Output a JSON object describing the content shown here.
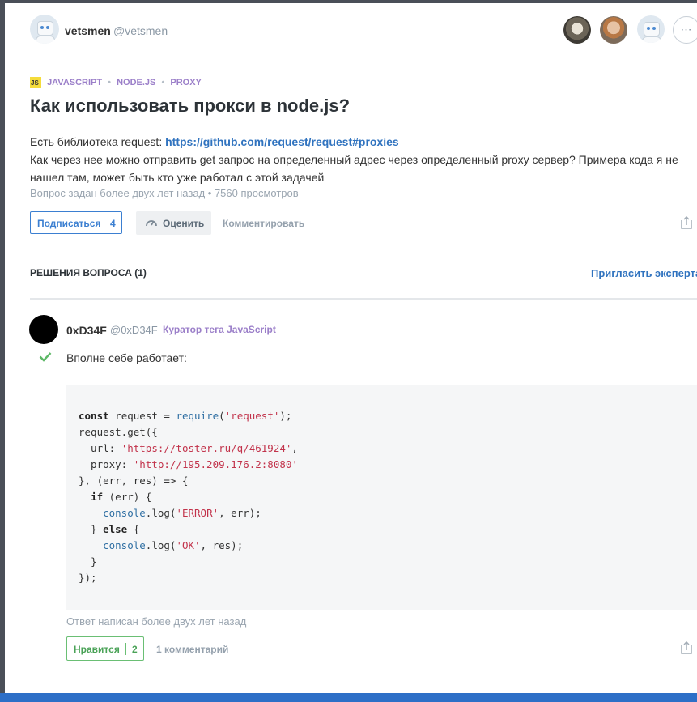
{
  "author": {
    "name": "vetsmen",
    "handle": "@vetsmen"
  },
  "subscribers_more_label": "⋯",
  "question": {
    "tags": [
      "JAVASCRIPT",
      "NODE.JS",
      "PROXY"
    ],
    "tag_icon_text": "JS",
    "title": "Как использовать прокси в node.js?",
    "body_line1_prefix": "Есть библиотека request: ",
    "body_link": "https://github.com/request/request#proxies",
    "body_line2": "Как через нее можно отправить get запрос на определенный адрес через определенный proxy сервер? Примера кода я не нашел там, может быть кто уже работал с этой задачей",
    "meta": "Вопрос задан более двух лет назад • 7560 просмотров",
    "subscribe_label": "Подписаться",
    "subscribe_count": "4",
    "rate_label": "Оценить",
    "comment_label": "Комментировать"
  },
  "solutions": {
    "header": "РЕШЕНИЯ ВОПРОСА (1)",
    "invite_label": "Пригласить эксперта"
  },
  "answer": {
    "name": "0xD34F",
    "handle": "@0xD34F",
    "curator": "Куратор тега JavaScript",
    "text": "Вполне себе работает:",
    "code_lines": [
      "const request = require('request');",
      "request.get({",
      "  url: 'https://toster.ru/q/461924',",
      "  proxy: 'http://195.209.176.2:8080'",
      "}, (err, res) => {",
      "  if (err) {",
      "    console.log('ERROR', err);",
      "  } else {",
      "    console.log('OK', res);",
      "  }",
      "});"
    ],
    "meta": "Ответ написан более двух лет назад",
    "like_label": "Нравится",
    "like_count": "2",
    "comments_label": "1 комментарий"
  },
  "colors": {
    "link": "#3073bf",
    "tag": "#9b7fc9",
    "accept": "#4aa257",
    "code_bg": "#f5f6f7"
  }
}
